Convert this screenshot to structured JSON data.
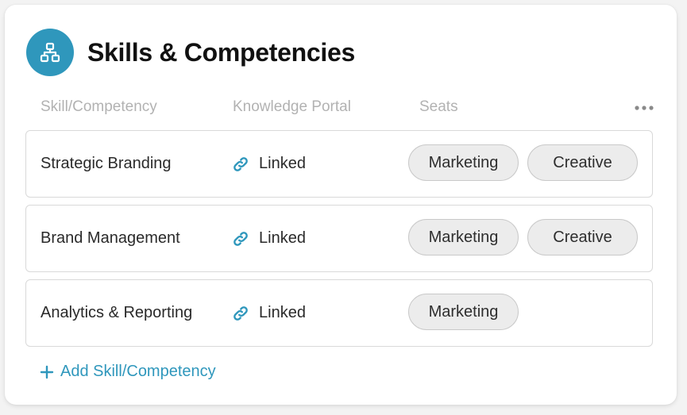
{
  "card": {
    "title": "Skills & Competencies",
    "title_icon": "hierarchy-icon",
    "accent_color": "#2f97bc"
  },
  "columns": {
    "skill": "Skill/Competency",
    "portal": "Knowledge Portal",
    "seats": "Seats",
    "more_icon": "more-horizontal-icon"
  },
  "rows": [
    {
      "skill": "Strategic Branding",
      "portal_status": "Linked",
      "seats": [
        "Marketing",
        "Creative"
      ]
    },
    {
      "skill": "Brand Management",
      "portal_status": "Linked",
      "seats": [
        "Marketing",
        "Creative"
      ]
    },
    {
      "skill": "Analytics & Reporting",
      "portal_status": "Linked",
      "seats": [
        "Marketing"
      ]
    }
  ],
  "add_button": {
    "label": "Add Skill/Competency",
    "icon": "plus-icon"
  }
}
